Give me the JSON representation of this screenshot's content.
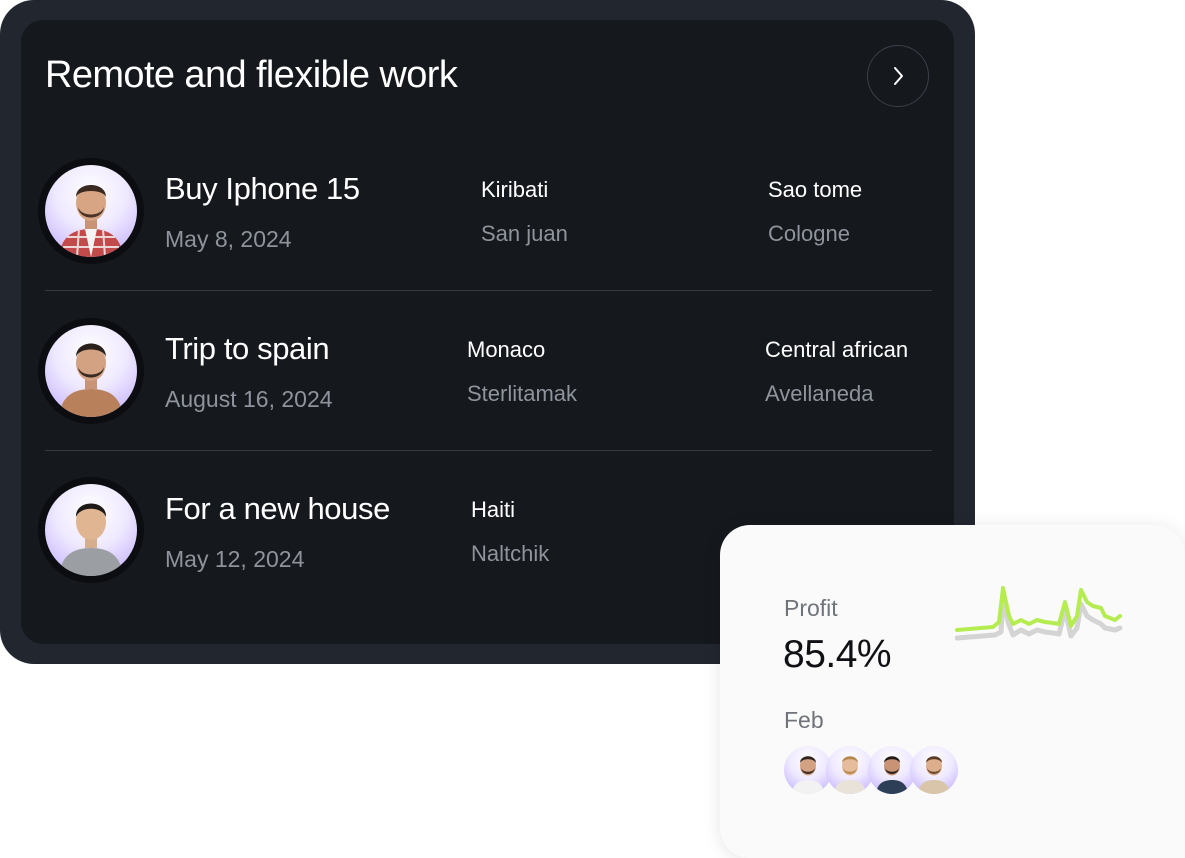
{
  "card": {
    "title": "Remote and flexible work",
    "rows": [
      {
        "title": "Buy Iphone 15",
        "date": "May 8, 2024",
        "col1": {
          "top": "Kiribati",
          "bottom": "San juan"
        },
        "col2": {
          "top": "Sao tome",
          "bottom": "Cologne"
        }
      },
      {
        "title": "Trip to spain",
        "date": "August 16, 2024",
        "col1": {
          "top": "Monaco",
          "bottom": "Sterlitamak"
        },
        "col2": {
          "top": "Central african",
          "bottom": "Avellaneda"
        }
      },
      {
        "title": "For a new house",
        "date": "May 12, 2024",
        "col1": {
          "top": "Haiti",
          "bottom": "Naltchik"
        }
      }
    ]
  },
  "profit": {
    "label": "Profit",
    "value": "85.4%",
    "month": "Feb"
  },
  "icons": {
    "next": "chevron-right-icon"
  },
  "colors": {
    "outer": "#22262f",
    "inner": "#15181d",
    "accent_line": "#b4ec51",
    "shadow_line": "#d4d4d4",
    "avatar_bg": "#bba6ff"
  }
}
